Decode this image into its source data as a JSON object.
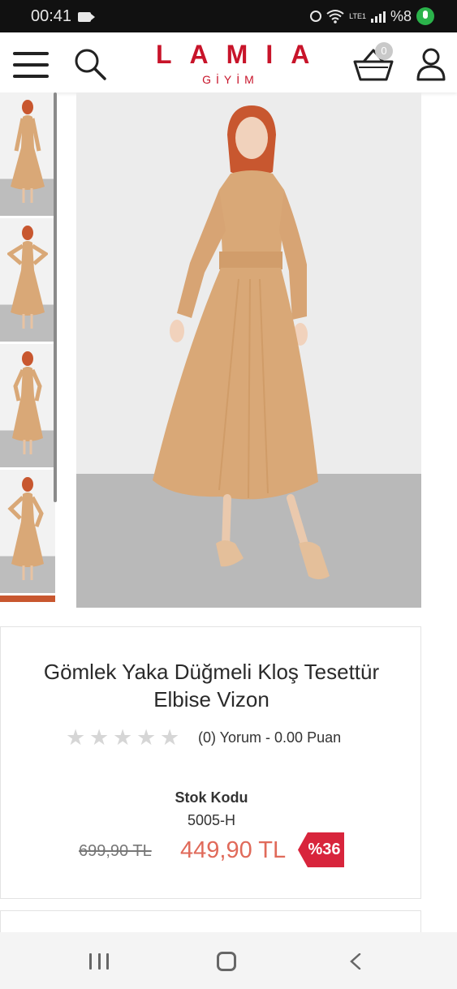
{
  "status_bar": {
    "time": "00:41",
    "battery": "%8",
    "network": "LTE1",
    "icons": [
      "video-camera-icon",
      "alarm-icon",
      "wifi-icon",
      "signal-icon",
      "microphone-icon"
    ]
  },
  "header": {
    "logo_main": "LAMIA",
    "logo_sub": "GİYİM",
    "cart_count": "0",
    "brand_color": "#c8142a",
    "icons": [
      "menu-icon",
      "search-icon",
      "cart-icon",
      "user-icon"
    ]
  },
  "product": {
    "title": "Gömlek Yaka Düğmeli Kloş Tesettür Elbise Vizon",
    "rating_stars": 0,
    "rating_text": "(0) Yorum - 0.00 Puan",
    "stock_label": "Stok Kodu",
    "stock_code": "5005-H",
    "old_price": "699,90 TL",
    "new_price": "449,90 TL",
    "discount": "%36",
    "price_color": "#e06a5a",
    "discount_color": "#d8253c"
  },
  "gallery": {
    "thumbnail_count": 4,
    "dress_color": "#d9a877",
    "hijab_color": "#c8572f"
  },
  "nav_bar": {
    "icons": [
      "recent-apps-icon",
      "home-icon",
      "back-icon"
    ]
  }
}
